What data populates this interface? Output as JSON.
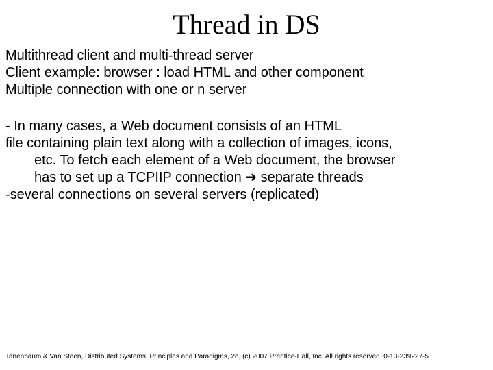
{
  "title": "Thread in DS",
  "intro": {
    "l1": "Multithread client and multi-thread server",
    "l2": "Client example: browser : load HTML and other component",
    "l3": "Multiple connection with one or n server"
  },
  "body": {
    "l1": "- In many cases, a Web document consists of an HTML",
    "l2": "file containing plain text along with a collection of images, icons,",
    "l3": "etc. To fetch each element of a Web document, the browser",
    "l4a": "has to set up a TCPIIP connection ",
    "arrow": "➜",
    "l4b": " separate threads",
    "l5": "-several connections on several servers (replicated)"
  },
  "footer": "Tanenbaum & Van Steen, Distributed Systems: Principles and Paradigms, 2e, (c) 2007 Prentice-Hall, Inc. All rights reserved. 0-13-239227-5"
}
